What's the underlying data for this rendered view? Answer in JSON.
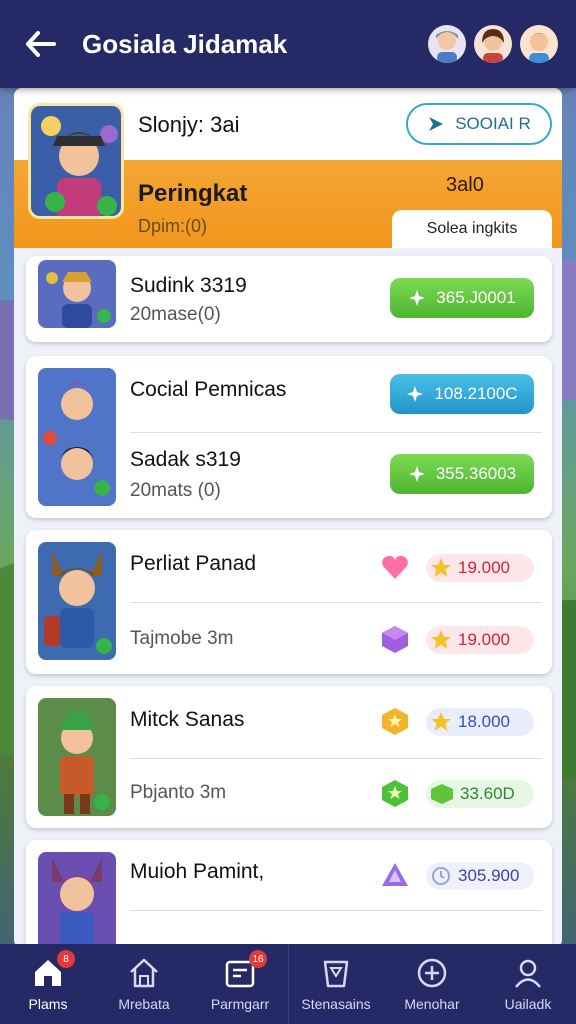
{
  "header": {
    "title": "Gosiala Jidamak"
  },
  "top_card": {
    "name": "Slonjy: 3ai",
    "social_button": "SOOIAI R",
    "rank_title": "Peringkat",
    "rank_sub": "Dpim:(0)",
    "rank_value": "3al0",
    "sort_tab": "Solea ingkits"
  },
  "list": [
    {
      "name": "Sudink 3319",
      "sub": "20mase(0)",
      "pill": "365.J0001",
      "pill_color": "green"
    },
    {
      "name": "Cocial Pemnicas",
      "pill": "108.2100C",
      "pill_color": "blue",
      "name2": "Sadak s319",
      "sub2": "20mats (0)",
      "pill2": "355.36003",
      "pill2_color": "green"
    },
    {
      "name": "Perliat Panad",
      "sub": "Tajmobe 3m",
      "score1": "19.000",
      "score2": "19.000",
      "gem1": "heart-gem",
      "gem2": "purple-box"
    },
    {
      "name": "Mitck Sanas",
      "sub": "Pbjanto 3m",
      "score1": "18.000",
      "score2": "33.60D",
      "gem1": "gold-shield",
      "gem2": "green-star"
    },
    {
      "name": "Muioh Pamint,",
      "sub": "",
      "score1": "305.900",
      "gem1": "purple-triangle"
    }
  ],
  "nav": [
    {
      "label": "Plams",
      "badge": "8",
      "icon": "home-icon",
      "active": true
    },
    {
      "label": "Mrebata",
      "badge": "",
      "icon": "house-outline-icon",
      "active": false
    },
    {
      "label": "Parmgarr",
      "badge": "16",
      "icon": "gift-icon",
      "active": false
    },
    {
      "label": "Stenasains",
      "badge": "",
      "icon": "cup-icon",
      "active": false
    },
    {
      "label": "Menohar",
      "badge": "",
      "icon": "plus-circle-icon",
      "active": false
    },
    {
      "label": "Uailadk",
      "badge": "",
      "icon": "user-icon",
      "active": false
    }
  ],
  "colors": {
    "header_bg": "#252a66",
    "orange": "#f2961d",
    "green_pill": "#4cb52e",
    "blue_pill": "#2395c9"
  }
}
